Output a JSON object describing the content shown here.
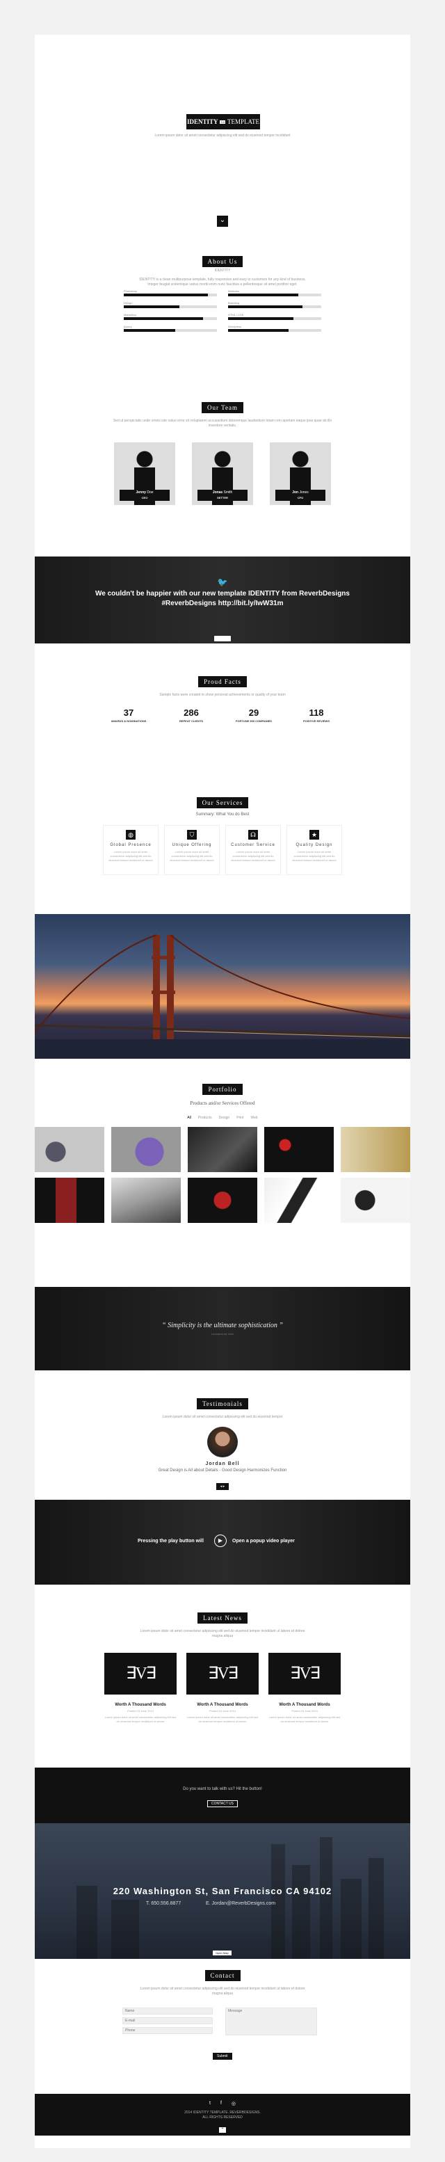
{
  "hero": {
    "logo_bold": "IDENTITY",
    "logo_light": "TEMPLATE",
    "logo_sub": "3.0",
    "tagline": "Lorem ipsum dolor sit amet consectetur adipiscing elit sed do eiusmod tempor incididunt",
    "scroll_label": "⌄"
  },
  "about": {
    "title": "About Us",
    "subtitle": "IDENTITY",
    "text1": "IDENTITY is a clean multipurpose template, fully responsive and easy to customize for any kind of business.",
    "text2": "Integer feugiat scelerisque varius morbi enim nunc faucibus a pellentesque sit amet porttitor eget.",
    "skills": [
      {
        "label": "Photoshop",
        "value": 90
      },
      {
        "label": "Illustrator",
        "value": 75
      },
      {
        "label": "Design",
        "value": 60
      },
      {
        "label": "Branding",
        "value": 80
      },
      {
        "label": "Marketing",
        "value": 85
      },
      {
        "label": "HTML / CSS",
        "value": 70
      },
      {
        "label": "jQuery",
        "value": 55
      },
      {
        "label": "Wordpress",
        "value": 65
      }
    ]
  },
  "team": {
    "title": "Our Team",
    "text": "Sed ut perspiciatis unde omnis iste natus error sit voluptatem accusantium doloremque laudantium totam rem aperiam eaque ipsa quae ab illo inventore veritatis.",
    "members": [
      {
        "first": "Jenny",
        "last": "Doe",
        "role": "CEO"
      },
      {
        "first": "Jonas",
        "last": "Smith",
        "role": "SETTER"
      },
      {
        "first": "Jon",
        "last": "Jones",
        "role": "CFO"
      }
    ]
  },
  "twitter": {
    "icon": "twitter-icon",
    "line1": "We couldn't be happier with our new template IDENTITY from ReverbDesigns",
    "line2": "#ReverbDesigns http://bit.ly/IwW31m"
  },
  "facts": {
    "title": "Proud Facts",
    "text": "Sample facts were created to show personal achievements or quality of your team",
    "items": [
      {
        "value": "37",
        "label": "Awards & Nominations"
      },
      {
        "value": "286",
        "label": "Repeat Clients"
      },
      {
        "value": "29",
        "label": "Fortune 500 Companies"
      },
      {
        "value": "118",
        "label": "Positive Reviews"
      }
    ]
  },
  "services": {
    "title": "Our Services",
    "subtitle": "Summary: What You do Best",
    "items": [
      {
        "icon": "globe-icon",
        "title": "Global Presence",
        "text": "Lorem ipsum dolor sit amet consectetur adipiscing elit sed do eiusmod tempor incididunt ut labore"
      },
      {
        "icon": "shield-icon",
        "title": "Unique Offering",
        "text": "Lorem ipsum dolor sit amet consectetur adipiscing elit sed do eiusmod tempor incididunt ut labore"
      },
      {
        "icon": "headset-icon",
        "title": "Customer Service",
        "text": "Lorem ipsum dolor sit amet consectetur adipiscing elit sed do eiusmod tempor incididunt ut labore"
      },
      {
        "icon": "star-icon",
        "title": "Quality Design",
        "text": "Lorem ipsum dolor sit amet consectetur adipiscing elit sed do eiusmod tempor incididunt ut labore"
      }
    ]
  },
  "portfolio": {
    "title": "Portfolio",
    "subtitle": "Products and/or Services Offered",
    "filters": [
      "All",
      "Products",
      "Design",
      "Print",
      "Web"
    ],
    "items": [
      "speakers",
      "purple-speaker",
      "car-interior",
      "red-speakers",
      "gadget",
      "tower-speaker",
      "laptop",
      "headphones",
      "phones",
      "sphere-speakers"
    ]
  },
  "quote": {
    "text": "“ Simplicity is the ultimate sophistication ”",
    "author": "Leonardo da Vinci"
  },
  "testimonials": {
    "title": "Testimonials",
    "text": "Lorem ipsum dolor sit amet consectetur adipiscing elit sed do eiusmod tempor",
    "name": "Jordan Bell",
    "quote": "Great Design is All about Details - Good Design Harmonizes Function",
    "nav": "◂ ▸"
  },
  "video": {
    "left": "Pressing the play button will",
    "right": "Open a popup video player"
  },
  "news": {
    "title": "Latest News",
    "text": "Lorem ipsum dolor sit amet consectetur adipiscing elit sed do eiusmod tempor incididunt ut labore et dolore magna aliqua",
    "posts": [
      {
        "title": "Worth A Thousand Words",
        "date": "Posted 23 June 2014",
        "text": "Lorem ipsum dolor sit amet consectetur adipiscing elit sed do eiusmod tempor incididunt ut labore"
      },
      {
        "title": "Worth A Thousand Words",
        "date": "Posted 23 June 2014",
        "text": "Lorem ipsum dolor sit amet consectetur adipiscing elit sed do eiusmod tempor incididunt ut labore"
      },
      {
        "title": "Worth A Thousand Words",
        "date": "Posted 23 June 2014",
        "text": "Lorem ipsum dolor sit amet consectetur adipiscing elit sed do eiusmod tempor incididunt ut labore"
      }
    ]
  },
  "cta": {
    "text": "Do you want to talk with us? Hit the button!",
    "button": "CONTACT US"
  },
  "address": {
    "title": "220 Washington St, San Francisco CA 94102",
    "phone": "T. 650.556.8877",
    "email": "E. Jordan@ReverbDesigns.com",
    "map_toggle": "Open Map"
  },
  "contact": {
    "title": "Contact",
    "text": "Lorem ipsum dolor sit amet consectetur adipiscing elit sed do eiusmod tempor incididunt ut labore et dolore magna aliqua",
    "name_ph": "Name",
    "email_ph": "E-mail",
    "phone_ph": "Phone",
    "message_ph": "Message",
    "send": "Submit"
  },
  "footer": {
    "socials": [
      "twitter-icon",
      "facebook-icon",
      "dribbble-icon"
    ],
    "line1": "2014 IDENTITY TEMPLATE. REVERBDESIGNS.",
    "line2": "ALL RIGHTS RESERVED",
    "top": "⌃"
  }
}
